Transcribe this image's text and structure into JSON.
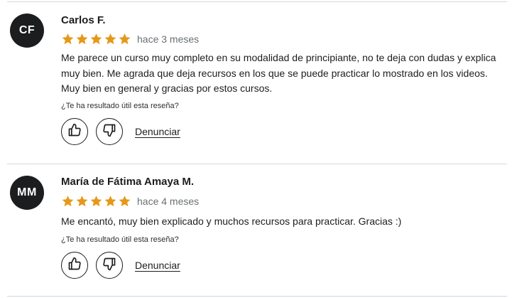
{
  "reviews": [
    {
      "initials": "CF",
      "name": "Carlos F.",
      "rating": 5,
      "time": "hace 3 meses",
      "text": "Me parece un curso muy completo en su modalidad de principiante, no te deja con dudas y explica muy bien. Me agrada que deja recursos en los que se puede practicar lo mostrado en los videos. Muy bien en general y gracias por estos cursos.",
      "helpful_question": "¿Te ha resultado útil esta reseña?",
      "report_label": "Denunciar"
    },
    {
      "initials": "MM",
      "name": "María de Fátima Amaya M.",
      "rating": 5,
      "time": "hace 4 meses",
      "text": "Me encantó, muy bien explicado y muchos recursos para practicar. Gracias :)",
      "helpful_question": "¿Te ha resultado útil esta reseña?",
      "report_label": "Denunciar"
    }
  ],
  "colors": {
    "star": "#e59819",
    "avatar_bg": "#1c1d1f",
    "divider": "#d1d7dc"
  },
  "icons": {
    "star": "star-icon",
    "like": "thumbs-up-icon",
    "dislike": "thumbs-down-icon"
  }
}
